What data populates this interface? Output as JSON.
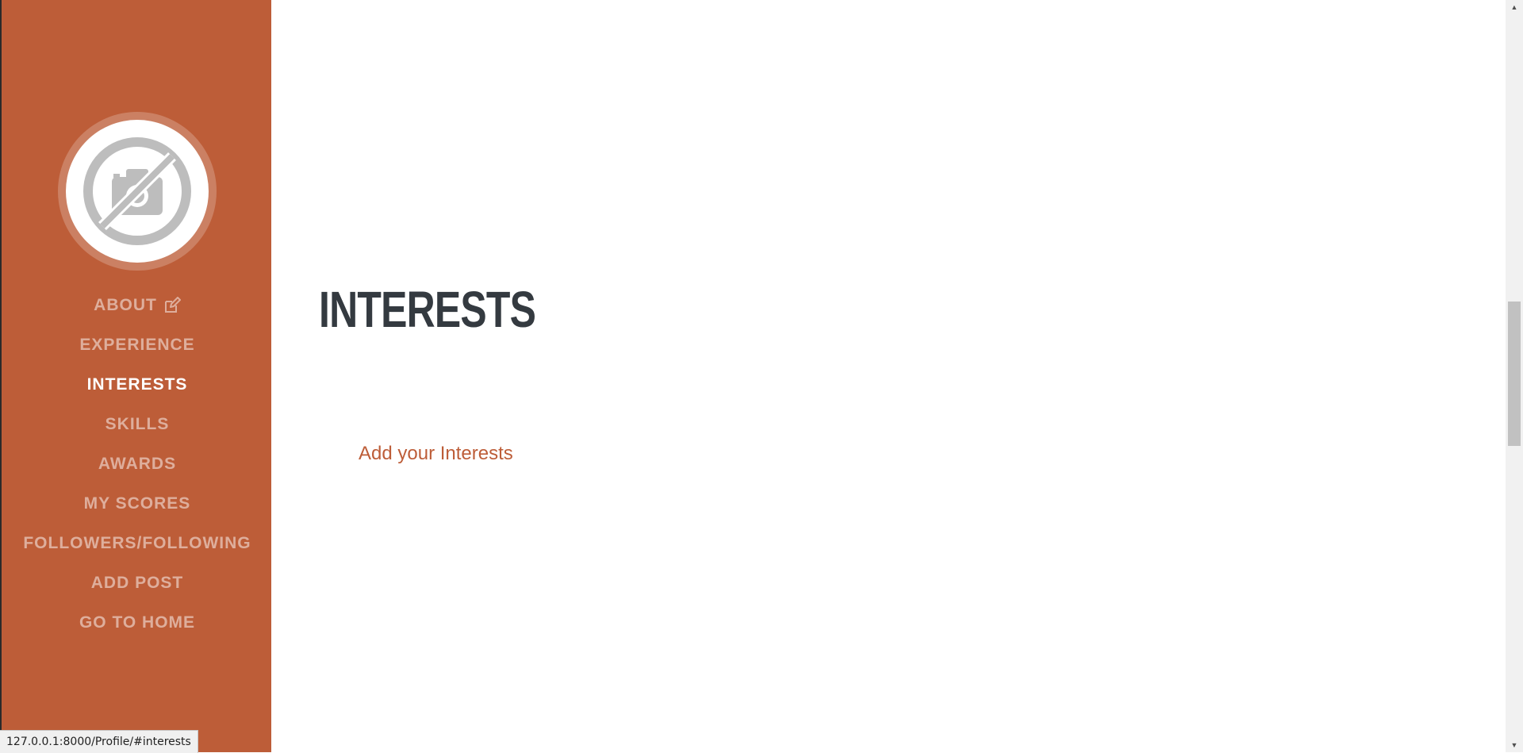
{
  "sidebar": {
    "avatar_icon": "no-camera-icon",
    "nav_items": [
      {
        "label": "ABOUT",
        "icon": "edit-icon",
        "active": false
      },
      {
        "label": "EXPERIENCE",
        "active": false
      },
      {
        "label": "INTERESTS",
        "active": true
      },
      {
        "label": "SKILLS",
        "active": false
      },
      {
        "label": "AWARDS",
        "active": false
      },
      {
        "label": "MY SCORES",
        "active": false
      },
      {
        "label": "FOLLOWERS/FOLLOWING",
        "active": false
      },
      {
        "label": "ADD POST",
        "active": false
      },
      {
        "label": "GO TO HOME",
        "active": false
      }
    ]
  },
  "main": {
    "section_title": "INTERESTS",
    "add_link": "Add your Interests"
  },
  "status_bar": {
    "url": "127.0.0.1:8000/Profile/#interests"
  },
  "colors": {
    "primary": "#bd5d38",
    "heading": "#343a40",
    "nav_inactive": "rgba(255,255,255,0.5)",
    "nav_active": "#ffffff"
  }
}
